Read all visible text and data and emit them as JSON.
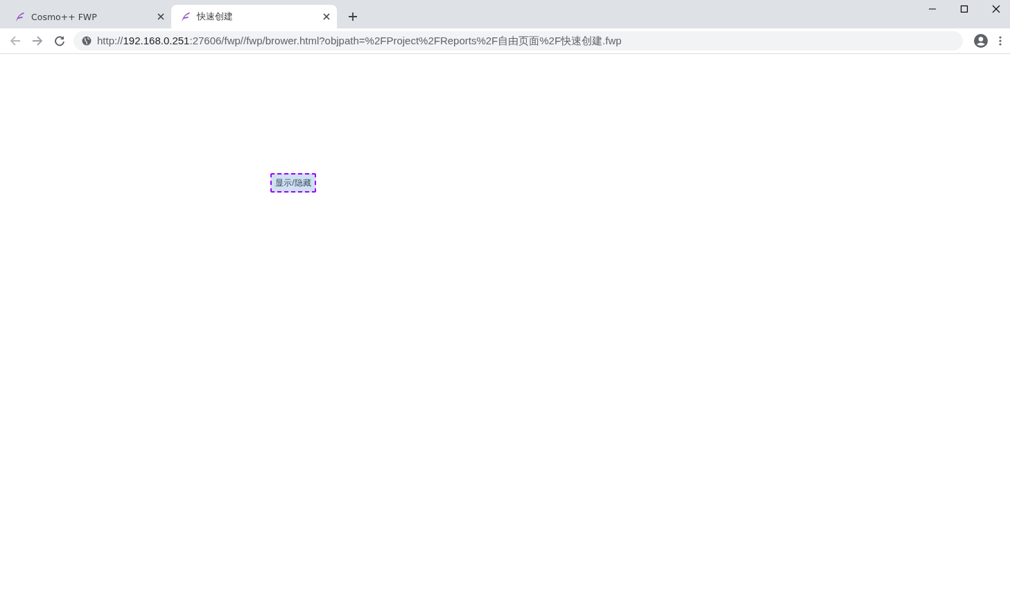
{
  "tabs": [
    {
      "title": "Cosmo++ FWP",
      "selected": false
    },
    {
      "title": "快速创建",
      "selected": true
    }
  ],
  "address_bar": {
    "scheme": "http://",
    "host": "192.168.0.251",
    "path": ":27606/fwp//fwp/brower.html?objpath=%2FProject%2FReports%2F自由页面%2F快速创建.fwp"
  },
  "page": {
    "button": {
      "label": "显示/隐藏"
    }
  }
}
